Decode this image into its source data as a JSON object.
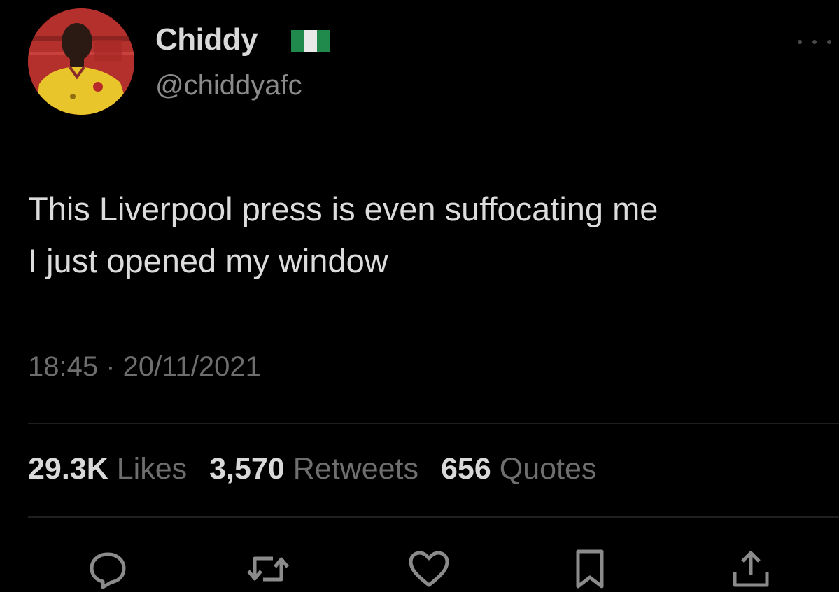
{
  "author": {
    "display_name": "Chiddy",
    "handle": "@chiddyafc",
    "flag_icon": "nigeria-flag-icon",
    "flag_colors": [
      "#008751",
      "#ffffff",
      "#008751"
    ]
  },
  "tweet": {
    "text_lines": [
      "This Liverpool press is even suffocating me",
      "I just opened my window"
    ],
    "timestamp": "18:45 · 20/11/2021"
  },
  "stats": {
    "likes_count": "29.3K",
    "likes_label": "Likes",
    "retweets_count": "3,570",
    "retweets_label": "Retweets",
    "quotes_count": "656",
    "quotes_label": "Quotes"
  },
  "actions": [
    {
      "icon": "reply-icon"
    },
    {
      "icon": "retweet-icon"
    },
    {
      "icon": "like-icon"
    },
    {
      "icon": "bookmark-icon"
    },
    {
      "icon": "share-icon"
    }
  ],
  "colors": {
    "background": "#000000",
    "primary_text": "#d9d9d9",
    "secondary_text": "#6e6e6e",
    "divider": "#1f1f1f",
    "icon": "#8b8b8b"
  }
}
